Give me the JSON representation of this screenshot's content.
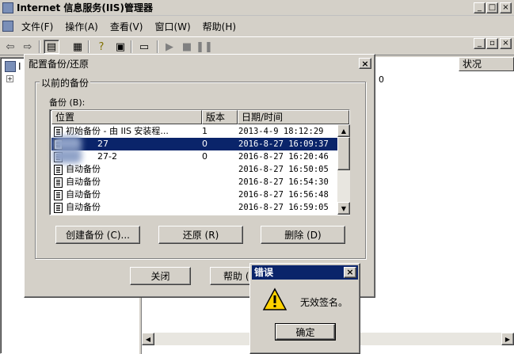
{
  "app": {
    "title": "Internet 信息服务(IIS)管理器",
    "window_buttons": [
      "_",
      "□",
      "×"
    ]
  },
  "menubar": {
    "items": [
      "文件(F)",
      "操作(A)",
      "查看(V)",
      "窗口(W)",
      "帮助(H)"
    ]
  },
  "main": {
    "right_header_status": "状况",
    "right_cell_value": "0",
    "tree_first_letter": "I"
  },
  "dialog": {
    "title": "配置备份/还原",
    "close": "×",
    "group_label": "以前的备份",
    "list_label": "备份 (B):",
    "columns": [
      "位置",
      "版本",
      "日期/时间"
    ],
    "rows": [
      {
        "location": "初始备份 - 由 IIS 安装程...",
        "version": "1",
        "datetime": "2013-4-9 18:12:29",
        "selected": false
      },
      {
        "location": "27",
        "version": "0",
        "datetime": "2016-8-27 16:09:37",
        "selected": true
      },
      {
        "location": "27-2",
        "version": "0",
        "datetime": "2016-8-27 16:20:46",
        "selected": false
      },
      {
        "location": "自动备份",
        "version": "",
        "datetime": "2016-8-27 16:50:05",
        "selected": false
      },
      {
        "location": "自动备份",
        "version": "",
        "datetime": "2016-8-27 16:54:30",
        "selected": false
      },
      {
        "location": "自动备份",
        "version": "",
        "datetime": "2016-8-27 16:56:48",
        "selected": false
      },
      {
        "location": "自动备份",
        "version": "",
        "datetime": "2016-8-27 16:59:05",
        "selected": false
      }
    ],
    "buttons": {
      "create": "创建备份 (C)...",
      "restore": "还原 (R)",
      "delete": "删除 (D)",
      "close": "关闭",
      "help": "帮助 (H)"
    }
  },
  "error_dialog": {
    "title": "错误",
    "message": "无效签名。",
    "ok": "确定",
    "close": "×"
  }
}
